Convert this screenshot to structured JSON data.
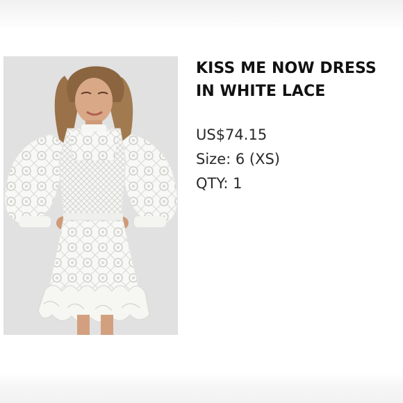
{
  "listing": {
    "title": "KISS ME NOW DRESS IN WHITE LACE",
    "price": "US$74.15",
    "size": "Size: 6 (XS)",
    "quantity": "QTY: 1"
  },
  "image": {
    "subject": "white lace mini dress with long puff sleeves and ruffle hem"
  },
  "colors": {
    "text": "#111111",
    "meta_text": "#2a2a2a",
    "photo_background": "#e2e2e2",
    "dress": "#f7f7f5"
  }
}
